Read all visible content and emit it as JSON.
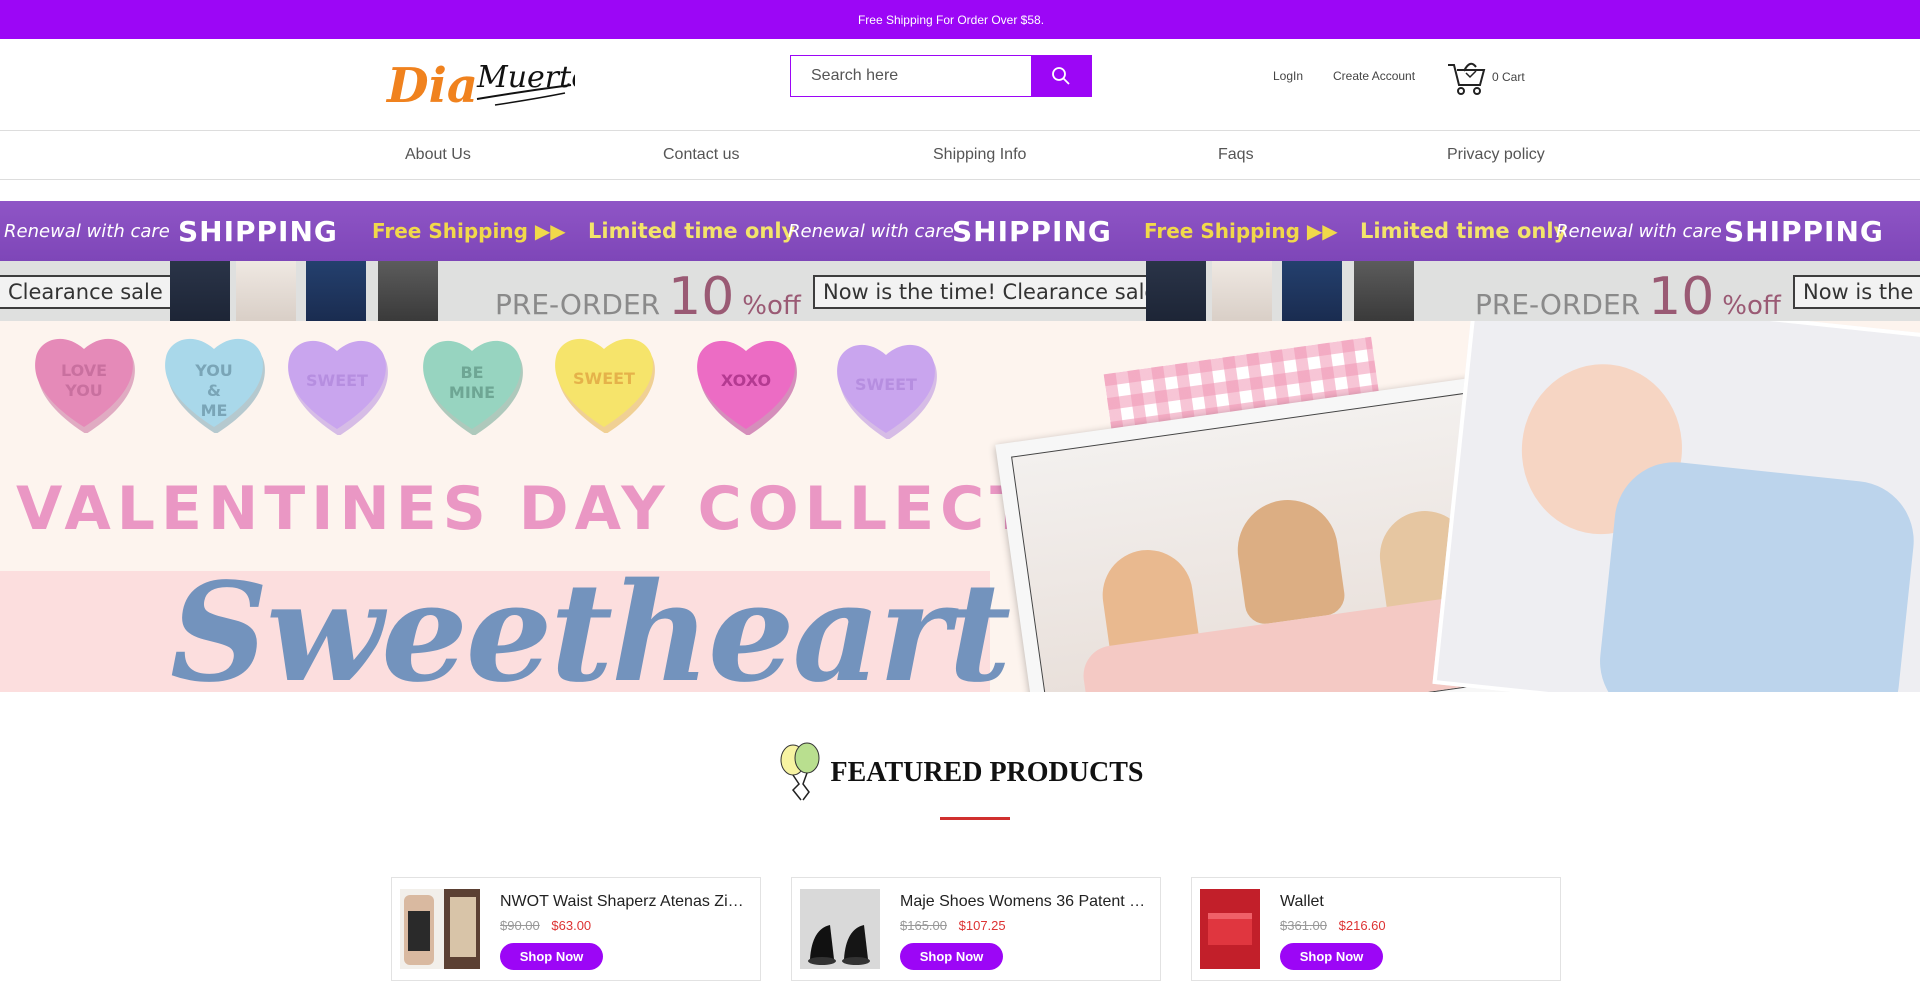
{
  "announcement": {
    "text": "Free Shipping For Order Over $58."
  },
  "header": {
    "logo_text": "Dia Muertos",
    "search": {
      "placeholder": "Search here",
      "value": ""
    },
    "login_label": "LogIn",
    "create_account_label": "Create Account",
    "cart_label": "0 Cart"
  },
  "nav": {
    "items": [
      {
        "label": "About Us"
      },
      {
        "label": "Contact us"
      },
      {
        "label": "Shipping Info"
      },
      {
        "label": "Faqs"
      },
      {
        "label": "Privacy policy"
      }
    ]
  },
  "marquee": {
    "renewal": "Renewal with care",
    "shipping": "SHIPPING",
    "free_shipping": "Free Shipping ▶▶",
    "limited": "Limited time only",
    "clearance": "Clearance sale",
    "preorder": "PRE-ORDER",
    "discount_number": "10",
    "discount_unit": "%off",
    "now_clearance": "Now is the time! Clearance sale",
    "now_clearance_cut": "Now is the t"
  },
  "hero": {
    "hearts": [
      {
        "text": "LOVE YOU",
        "color": "#e58ab8",
        "text_color": "#c9709f"
      },
      {
        "text": "YOU & ME",
        "color": "#a9d8ea",
        "text_color": "#7aa5b7"
      },
      {
        "text": "SWEET",
        "color": "#c9a5ee",
        "text_color": "#b68ee0"
      },
      {
        "text": "BE MINE",
        "color": "#97d4c0",
        "text_color": "#6ea694"
      },
      {
        "text": "SWEET",
        "color": "#f6e46b",
        "text_color": "#e5b24a"
      },
      {
        "text": "XOXO",
        "color": "#ec6cc4",
        "text_color": "#b43a91"
      },
      {
        "text": "SWEET",
        "color": "#c9a5ee",
        "text_color": "#b68ee0"
      }
    ],
    "collection_title": "VALENTINES DAY COLLECTION",
    "script_title": "Sweetheart"
  },
  "featured": {
    "title": "FEATURED PRODUCTS",
    "accent_color": "#d0302f"
  },
  "products": [
    {
      "name": "NWOT Waist Shaperz Atenas Zi…",
      "old_price": "$90.00",
      "price": "$63.00",
      "button": "Shop Now"
    },
    {
      "name": "Maje Shoes Womens 36 Patent …",
      "old_price": "$165.00",
      "price": "$107.25",
      "button": "Shop Now"
    },
    {
      "name": "Wallet",
      "old_price": "$361.00",
      "price": "$216.60",
      "button": "Shop Now"
    }
  ],
  "colors": {
    "brand": "#9c06f6",
    "sale": "#dd3333"
  }
}
